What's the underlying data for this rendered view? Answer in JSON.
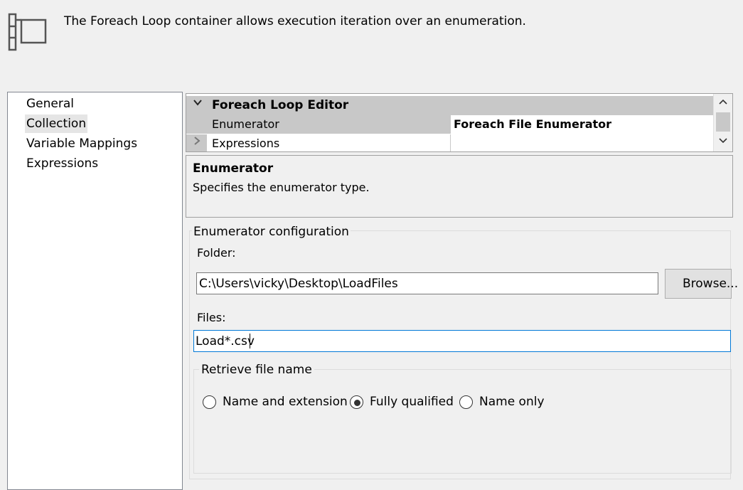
{
  "header": {
    "description": "The Foreach Loop container allows execution iteration over an enumeration.",
    "icon": "foreach-loop-container-icon"
  },
  "nav": {
    "items": [
      {
        "label": "General",
        "selected": false
      },
      {
        "label": "Collection",
        "selected": true
      },
      {
        "label": "Variable Mappings",
        "selected": false
      },
      {
        "label": "Expressions",
        "selected": false
      }
    ]
  },
  "property_grid": {
    "category": "Foreach Loop Editor",
    "rows": [
      {
        "name": "Enumerator",
        "value": "Foreach File Enumerator"
      },
      {
        "name": "Expressions",
        "value": ""
      }
    ]
  },
  "description_pane": {
    "title": "Enumerator",
    "text": "Specifies the enumerator type."
  },
  "enumerator_config": {
    "title": "Enumerator configuration",
    "folder_label": "Folder:",
    "folder_value": "C:\\Users\\vicky\\Desktop\\LoadFiles",
    "browse_label": "Browse...",
    "files_label": "Files:",
    "files_value": "Load*.csv"
  },
  "retrieve_file_name": {
    "title": "Retrieve file name",
    "options": [
      {
        "label": "Name and extension",
        "checked": false
      },
      {
        "label": "Fully qualified",
        "checked": true
      },
      {
        "label": "Name only",
        "checked": false
      }
    ]
  }
}
